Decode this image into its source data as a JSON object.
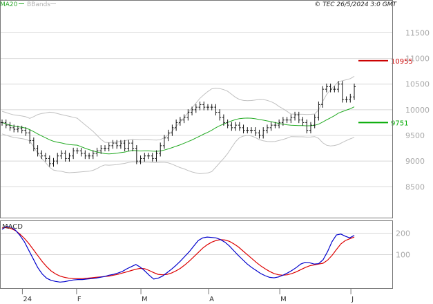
{
  "chart_data": {
    "type": "candlestick",
    "header": "© TEC 26/5/2024 3:0 GMT",
    "legend": [
      {
        "label": "MA20",
        "color": "#22aa22"
      },
      {
        "label": "BBands",
        "color": "#b0b0b0"
      }
    ],
    "price_ylim": [
      8100,
      11950
    ],
    "price_ticks": [
      8500,
      9000,
      9500,
      10000,
      10500,
      11000,
      11500
    ],
    "levels": [
      {
        "label": "10955",
        "value": 10955,
        "color": "#cc0000"
      },
      {
        "label": "9751",
        "value": 9751,
        "color": "#00aa00"
      }
    ],
    "x_labels": [
      {
        "label": "24",
        "index": 6
      },
      {
        "label": "F",
        "index": 22
      },
      {
        "label": "M",
        "index": 41
      },
      {
        "label": "A",
        "index": 61
      },
      {
        "label": "M",
        "index": 82
      },
      {
        "label": "J",
        "index": 103
      }
    ],
    "closes": [
      9750,
      9700,
      9650,
      9620,
      9630,
      9600,
      9550,
      9400,
      9250,
      9150,
      9100,
      9050,
      8950,
      9000,
      9100,
      9150,
      9050,
      9100,
      9200,
      9200,
      9150,
      9100,
      9100,
      9150,
      9200,
      9250,
      9250,
      9300,
      9350,
      9300,
      9350,
      9250,
      9350,
      9250,
      9000,
      9050,
      9100,
      9100,
      9050,
      9150,
      9300,
      9450,
      9550,
      9650,
      9750,
      9800,
      9850,
      9950,
      10000,
      10050,
      10100,
      10050,
      10050,
      10050,
      9950,
      9850,
      9750,
      9700,
      9650,
      9700,
      9650,
      9600,
      9600,
      9600,
      9550,
      9500,
      9600,
      9650,
      9700,
      9700,
      9750,
      9800,
      9800,
      9850,
      9900,
      9800,
      9750,
      9600,
      9700,
      9850,
      10100,
      10400,
      10450,
      10400,
      10400,
      10500,
      10200,
      10200,
      10250,
      10450
    ],
    "macd": {
      "ylim": [
        -40,
        250
      ],
      "ticks": [
        100,
        200
      ],
      "label": "MACD",
      "macd": [
        218,
        232,
        228,
        214,
        190,
        160,
        120,
        80,
        40,
        10,
        -10,
        -20,
        -25,
        -28,
        -26,
        -22,
        -18,
        -16,
        -16,
        -14,
        -12,
        -10,
        -6,
        -2,
        4,
        8,
        14,
        22,
        34,
        44,
        54,
        42,
        24,
        4,
        -14,
        -10,
        0,
        16,
        32,
        50,
        70,
        92,
        114,
        140,
        166,
        178,
        182,
        180,
        178,
        170,
        158,
        140,
        118,
        96,
        76,
        56,
        40,
        26,
        12,
        2,
        -6,
        -8,
        -4,
        4,
        14,
        26,
        40,
        56,
        64,
        62,
        56,
        58,
        76,
        114,
        160,
        192,
        196,
        186,
        178,
        190
      ],
      "signal": [
        225,
        226,
        222,
        212,
        196,
        176,
        152,
        124,
        96,
        68,
        44,
        24,
        10,
        0,
        -6,
        -10,
        -12,
        -12,
        -12,
        -10,
        -8,
        -6,
        -4,
        -2,
        0,
        4,
        8,
        14,
        20,
        26,
        32,
        36,
        34,
        26,
        16,
        8,
        6,
        8,
        14,
        24,
        36,
        52,
        70,
        90,
        110,
        130,
        146,
        158,
        166,
        170,
        168,
        162,
        150,
        136,
        118,
        100,
        82,
        64,
        48,
        34,
        22,
        12,
        6,
        4,
        6,
        12,
        20,
        30,
        40,
        48,
        52,
        56,
        60,
        74,
        96,
        124,
        150,
        166,
        174,
        182
      ]
    }
  }
}
